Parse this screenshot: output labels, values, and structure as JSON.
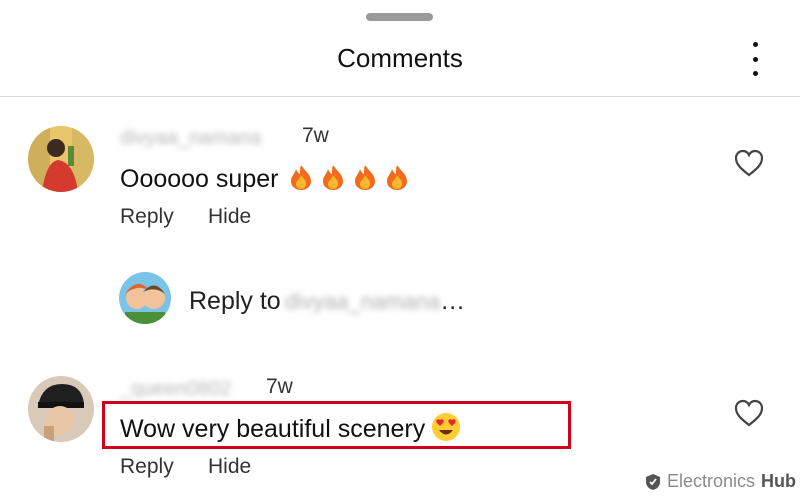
{
  "header": {
    "title": "Comments"
  },
  "comments": [
    {
      "username": "divyaa_namana",
      "time": "7w",
      "text": "Oooooo super",
      "emoji_count": 4,
      "actions": {
        "reply": "Reply",
        "hide": "Hide"
      }
    },
    {
      "username": "_queen0802",
      "time": "7w",
      "text": "Wow very beautiful scenery",
      "actions": {
        "reply": "Reply",
        "hide": "Hide"
      }
    }
  ],
  "reply_composer": {
    "prefix": "Reply to",
    "username": "divyaa_namana",
    "ellipsis": "…"
  },
  "watermark": {
    "brand": "Electronics",
    "suffix": "Hub"
  },
  "colors": {
    "highlight": "#d0021b",
    "divider": "#dbdbdb"
  }
}
